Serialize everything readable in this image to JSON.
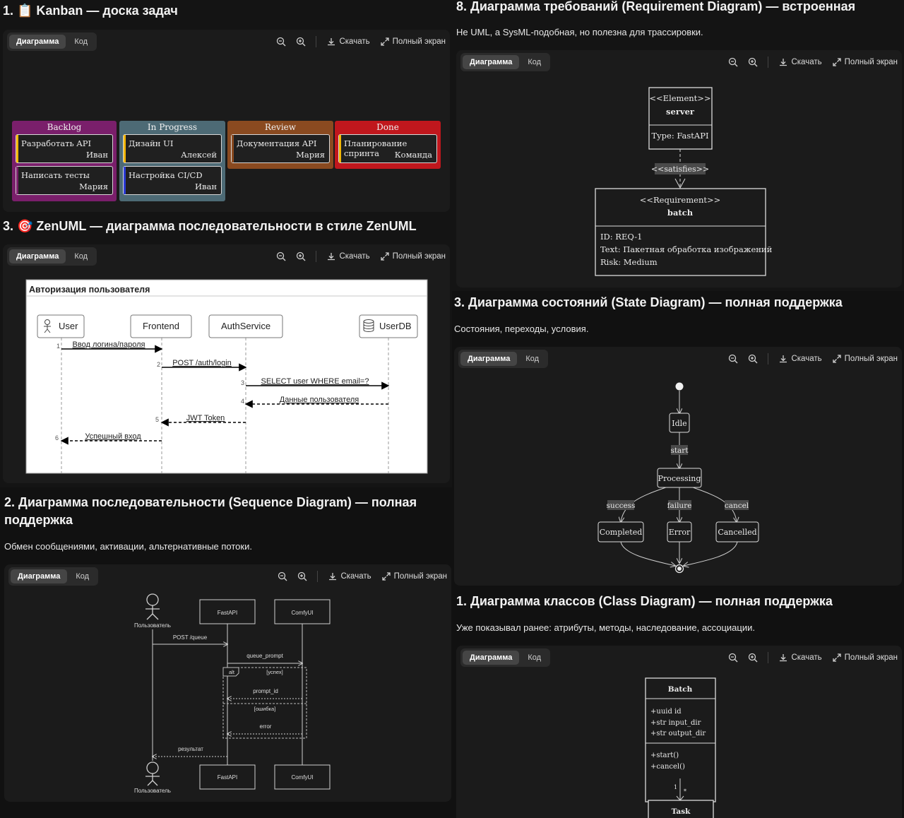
{
  "toolbar": {
    "tab_diagram": "Диаграмма",
    "tab_code": "Код",
    "download": "Скачать",
    "fullscreen": "Полный экран"
  },
  "kanban": {
    "title": "1. 📋 Kanban — доска задач",
    "columns": [
      {
        "title": "Backlog",
        "color": "#7a1f6b",
        "cards": [
          {
            "text": "Разработать API",
            "assignee": "Иван",
            "bar": "#f2b705"
          },
          {
            "text": "Написать тесты",
            "assignee": "Мария",
            "bar": "#7a1f6b"
          }
        ]
      },
      {
        "title": "In Progress",
        "color": "#4d6a75",
        "cards": [
          {
            "text": "Дизайн UI",
            "assignee": "Алексей",
            "bar": "#f2b705"
          },
          {
            "text": "Настройка CI/CD",
            "assignee": "Иван",
            "bar": "#2a3bd6"
          }
        ]
      },
      {
        "title": "Review",
        "color": "#8a4a20",
        "cards": [
          {
            "text": "Документация API",
            "assignee": "Мария",
            "bar": "#8a4a20"
          }
        ]
      },
      {
        "title": "Done",
        "color": "#c0171d",
        "cards": [
          {
            "text": "Планирование спринта",
            "assignee": "Команда",
            "bar": "#f2b705"
          }
        ]
      }
    ]
  },
  "zenuml": {
    "title": "3. 🎯 ZenUML — диаграмма последовательности в стиле ZenUML",
    "frame_title": "Авторизация пользователя",
    "participants": [
      "User",
      "Frontend",
      "AuthService",
      "UserDB"
    ],
    "messages": [
      {
        "n": "1",
        "text": "Ввод логина/пароля"
      },
      {
        "n": "2",
        "text": "POST /auth/login"
      },
      {
        "n": "3",
        "text": "SELECT user WHERE email=?"
      },
      {
        "n": "4",
        "text": "Данные пользователя"
      },
      {
        "n": "5",
        "text": "JWT Token"
      },
      {
        "n": "6",
        "text": "Успешный вход"
      }
    ]
  },
  "sequence": {
    "title_line1": "2. Диаграмма последовательности (Sequence Diagram) — полная",
    "title_line2": "поддержка",
    "desc": "Обмен сообщениями, активации, альтернативные потоки.",
    "actor": "Пользователь",
    "participants": [
      "FastAPI",
      "ComfyUI"
    ],
    "messages": [
      "POST /queue",
      "queue_prompt",
      "prompt_id",
      "error",
      "результат"
    ],
    "alt_label": "alt",
    "alt_cond1": "[успех]",
    "alt_cond2": "[ошибка]"
  },
  "requirement": {
    "title": "8. Диаграмма требований (Requirement Diagram) — встроенная",
    "desc": "Не UML, а SysML-подобная, но полезна для трассировки.",
    "element_stereo": "<<Element>>",
    "element_name": "server",
    "element_type": "Type: FastAPI",
    "relation": "<<satisfies>>",
    "req_stereo": "<<Requirement>>",
    "req_name": "batch",
    "req_id": "ID: REQ-1",
    "req_text": "Text: Пакетная обработка изображений",
    "req_risk": "Risk: Medium"
  },
  "state": {
    "title": "3. Диаграмма состояний (State Diagram) — полная поддержка",
    "desc": "Состояния, переходы, условия.",
    "states": [
      "Idle",
      "Processing",
      "Completed",
      "Error",
      "Cancelled"
    ],
    "transitions": [
      "start",
      "success",
      "failure",
      "cancel"
    ]
  },
  "class": {
    "title": "1. Диаграмма классов (Class Diagram) — полная поддержка",
    "desc": "Уже показывал ранее: атрибуты, методы, наследование, ассоциации.",
    "class_name": "Batch",
    "attributes": [
      "+uuid id",
      "+str input_dir",
      "+str output_dir"
    ],
    "methods": [
      "+start()",
      "+cancel()"
    ],
    "mult_left": "1",
    "mult_right": "*",
    "target": "Task"
  }
}
